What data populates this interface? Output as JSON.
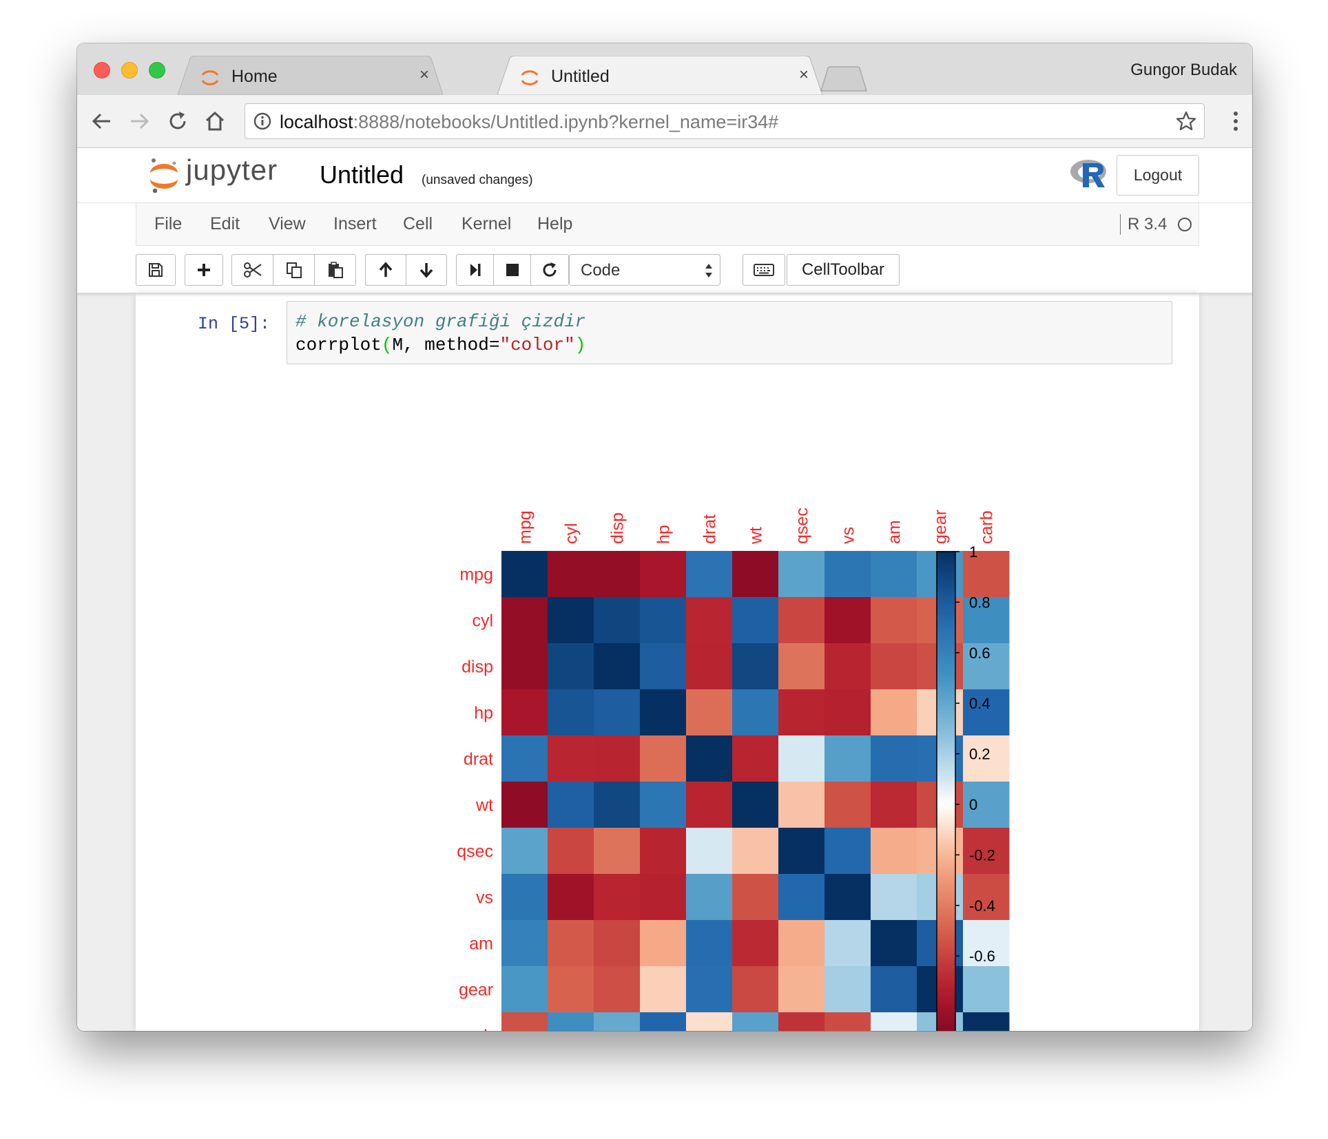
{
  "browser": {
    "tabs": [
      {
        "title": "Home",
        "close": "×",
        "active": false
      },
      {
        "title": "Untitled",
        "close": "×",
        "active": true
      }
    ],
    "profile_name": "Gungor Budak",
    "url_host": "localhost",
    "url_rest": ":8888/notebooks/Untitled.ipynb?kernel_name=ir34#"
  },
  "jupyter": {
    "logo_text": "jupyter",
    "notebook_name": "Untitled",
    "save_status": "(unsaved changes)",
    "logout_label": "Logout",
    "menu": [
      "File",
      "Edit",
      "View",
      "Insert",
      "Cell",
      "Kernel",
      "Help"
    ],
    "kernel_name": "R 3.4",
    "cell_type": "Code",
    "celltoolbar_label": "CellToolbar"
  },
  "cell": {
    "prompt": "In [5]:",
    "comment": "# korelasyon grafiği çizdir",
    "code_func": "corrplot",
    "code_open": "(",
    "code_args": "M, method=",
    "code_str": "\"color\"",
    "code_close": ")"
  },
  "colors": {
    "tab_icon": "#f37726",
    "label_red": "#f02b2b",
    "prompt_blue": "#303f9f"
  },
  "chart_data": {
    "type": "heatmap",
    "variables": [
      "mpg",
      "cyl",
      "disp",
      "hp",
      "drat",
      "wt",
      "qsec",
      "vs",
      "am",
      "gear",
      "carb"
    ],
    "colorbar_ticks": [
      "1",
      "0.8",
      "0.6",
      "0.4",
      "0.2",
      "0",
      "-0.2",
      "-0.4",
      "-0.6"
    ],
    "colorbar_range": [
      -1,
      1
    ],
    "matrix": [
      [
        1.0,
        -0.85,
        -0.85,
        -0.78,
        0.68,
        -0.87,
        0.42,
        0.66,
        0.6,
        0.48,
        -0.55
      ],
      [
        -0.85,
        1.0,
        0.9,
        0.83,
        -0.7,
        0.78,
        -0.59,
        -0.81,
        -0.52,
        -0.49,
        0.53
      ],
      [
        -0.85,
        0.9,
        1.0,
        0.79,
        -0.71,
        0.89,
        -0.43,
        -0.71,
        -0.59,
        -0.56,
        0.39
      ],
      [
        -0.78,
        0.83,
        0.79,
        1.0,
        -0.45,
        0.66,
        -0.71,
        -0.72,
        -0.24,
        -0.13,
        0.75
      ],
      [
        0.68,
        -0.7,
        -0.71,
        -0.45,
        1.0,
        -0.71,
        0.09,
        0.44,
        0.71,
        0.7,
        -0.09
      ],
      [
        -0.87,
        0.78,
        0.89,
        0.66,
        -0.71,
        1.0,
        -0.17,
        -0.55,
        -0.69,
        -0.58,
        0.43
      ],
      [
        0.42,
        -0.59,
        -0.43,
        -0.71,
        0.09,
        -0.17,
        1.0,
        0.74,
        -0.23,
        -0.21,
        -0.66
      ],
      [
        0.66,
        -0.81,
        -0.71,
        -0.72,
        0.44,
        -0.55,
        0.74,
        1.0,
        0.17,
        0.21,
        -0.57
      ],
      [
        0.6,
        -0.52,
        -0.59,
        -0.24,
        0.71,
        -0.69,
        -0.23,
        0.17,
        1.0,
        0.79,
        0.06
      ],
      [
        0.48,
        -0.49,
        -0.56,
        -0.13,
        0.7,
        -0.58,
        -0.21,
        0.21,
        0.79,
        1.0,
        0.27
      ],
      [
        -0.55,
        0.53,
        0.39,
        0.75,
        -0.09,
        0.43,
        -0.66,
        -0.57,
        0.06,
        0.27,
        1.0
      ]
    ]
  }
}
